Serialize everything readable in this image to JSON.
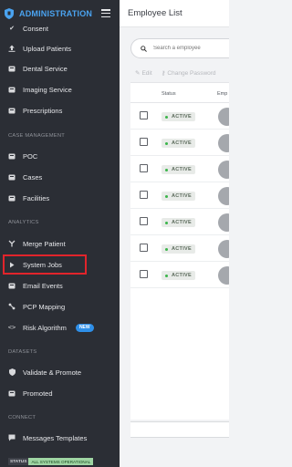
{
  "sidebar": {
    "app_title": "ADMINISTRATION",
    "items_top": [
      {
        "label": "Consent",
        "icon": "check-icon"
      },
      {
        "label": "Upload Patients",
        "icon": "upload-icon"
      },
      {
        "label": "Dental Service",
        "icon": "card-icon"
      },
      {
        "label": "Imaging Service",
        "icon": "card-icon"
      },
      {
        "label": "Prescriptions",
        "icon": "card-icon"
      }
    ],
    "sections": {
      "case_management": "CASE MANAGEMENT",
      "analytics": "ANALYTICS",
      "datasets": "DATASETS",
      "connect": "CONNECT"
    },
    "case_items": [
      {
        "label": "POC",
        "icon": "card-icon"
      },
      {
        "label": "Cases",
        "icon": "card-icon"
      },
      {
        "label": "Facilities",
        "icon": "card-icon"
      }
    ],
    "analytics_items": [
      {
        "label": "Merge Patient",
        "icon": "merge-icon"
      },
      {
        "label": "System Jobs",
        "icon": "play-icon"
      },
      {
        "label": "Email Events",
        "icon": "card-icon"
      },
      {
        "label": "PCP Mapping",
        "icon": "mapping-icon"
      },
      {
        "label": "Risk Algorithm",
        "icon": "code-icon",
        "badge": "NEW"
      }
    ],
    "dataset_items": [
      {
        "label": "Validate & Promote",
        "icon": "shield-icon"
      },
      {
        "label": "Promoted",
        "icon": "card-icon"
      }
    ],
    "connect_items": [
      {
        "label": "Messages Templates",
        "icon": "message-icon"
      }
    ],
    "status": {
      "label": "STATUS",
      "value": "ALL SYSTEMS OPERATIONAL"
    }
  },
  "main": {
    "title": "Employee List",
    "search_placeholder": "Search a employee",
    "toolbar": {
      "edit": "Edit",
      "change_password": "Change Password"
    },
    "columns": {
      "status": "Status",
      "employee": "Emp"
    },
    "rows": [
      {
        "status": "ACTIVE"
      },
      {
        "status": "ACTIVE"
      },
      {
        "status": "ACTIVE"
      },
      {
        "status": "ACTIVE"
      },
      {
        "status": "ACTIVE"
      },
      {
        "status": "ACTIVE"
      },
      {
        "status": "ACTIVE"
      }
    ]
  },
  "colors": {
    "sidebar_bg": "#2b2e35",
    "accent": "#4aa3f0",
    "highlight": "#e1242b",
    "active_dot": "#3bb54a",
    "new_badge": "#2e8fe8"
  }
}
